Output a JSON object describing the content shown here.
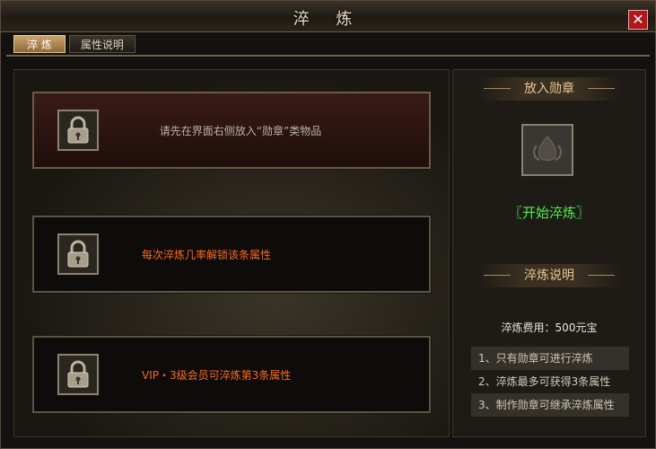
{
  "window": {
    "title": "淬 炼",
    "close_glyph": "✕"
  },
  "tabs": [
    {
      "label": "淬 炼",
      "active": true
    },
    {
      "label": "属性说明",
      "active": false
    }
  ],
  "slots": [
    {
      "text": "请先在界面右侧放入“勋章”类物品",
      "locked": true
    },
    {
      "text": "每次淬炼几率解锁该条属性",
      "locked": true
    },
    {
      "text": "VIP・3级会员可淬炼第3条属性",
      "locked": true
    }
  ],
  "right_panel": {
    "medal_header": "放入勋章",
    "start_button": "〖开始淬炼〗",
    "info_header": "淬炼说明",
    "cost_text": "淬炼费用：500元宝",
    "rules": [
      "1、只有勋章可进行淬炼",
      "2、淬炼最多可获得3条属性",
      "3、制作勋章可继承淬炼属性"
    ]
  },
  "colors": {
    "hint_text": "#b9b2a6",
    "warning_text": "#ff6a1a",
    "start_button": "#4ef04e",
    "header_text": "#e7c68f"
  }
}
